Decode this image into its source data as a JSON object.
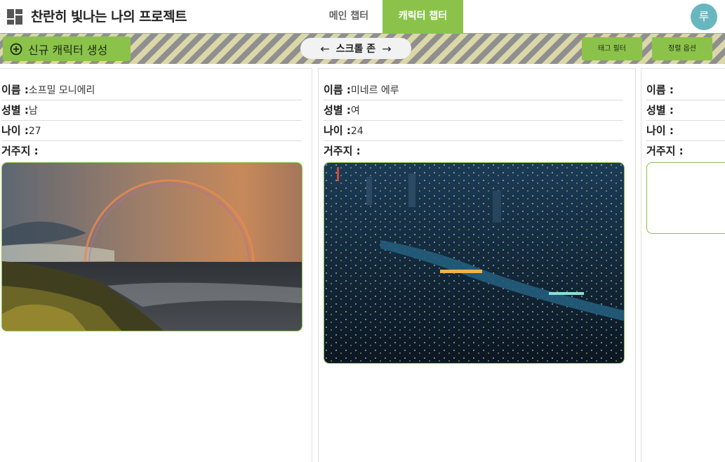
{
  "header": {
    "title": "찬란히 빛나는 나의 프로젝트",
    "tabs": [
      {
        "label": "메인 챕터",
        "active": false
      },
      {
        "label": "캐릭터 챕터",
        "active": true
      }
    ],
    "avatar_initial": "루",
    "accent_color": "#8bc34a",
    "avatar_color": "#68b7bf"
  },
  "toolbar": {
    "new_character_label": "신규 캐릭터 생성",
    "scroll_zone_label": "스크롤 존",
    "tag_filter_label": "태그 필터",
    "sort_options_label": "정렬 옵션",
    "icons": [
      "add-circle-icon",
      "arrow-left-icon",
      "arrow-right-icon"
    ]
  },
  "characters": [
    {
      "fields": [
        {
          "label": "이름 :",
          "value": "소프밀 모니에리"
        },
        {
          "label": "성별 :",
          "value": "남"
        },
        {
          "label": "나이 :",
          "value": "27"
        },
        {
          "label": "거주지 :",
          "value": ""
        }
      ],
      "image": "rainbow-over-sea-photo"
    },
    {
      "fields": [
        {
          "label": "이름 :",
          "value": "미네르 에루"
        },
        {
          "label": "성별 :",
          "value": "여"
        },
        {
          "label": "나이 :",
          "value": "24"
        },
        {
          "label": "거주지 :",
          "value": ""
        }
      ],
      "image": "night-city-photo"
    },
    {
      "fields": [
        {
          "label": "이름 :",
          "value": ""
        },
        {
          "label": "성별 :",
          "value": ""
        },
        {
          "label": "나이 :",
          "value": ""
        },
        {
          "label": "거주지 :",
          "value": ""
        }
      ],
      "image": "empty-image-placeholder"
    }
  ]
}
